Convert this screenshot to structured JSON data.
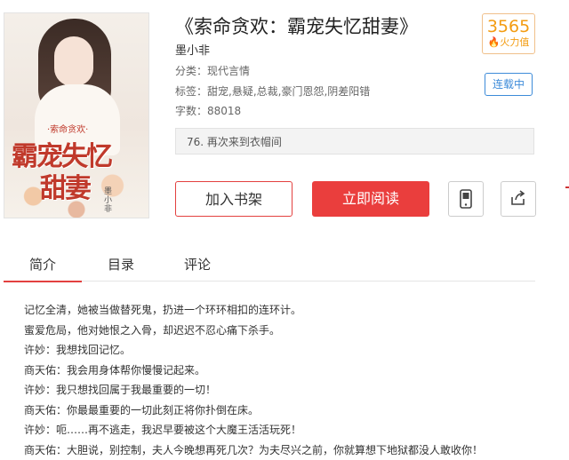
{
  "book": {
    "title": "《索命贪欢：霸宠失忆甜妻》",
    "author": "墨小非",
    "category_label": "分类：",
    "category": "现代言情",
    "tags_label": "标签：",
    "tags": "甜宠,悬疑,总裁,豪门恩怨,阴差阳错",
    "word_count_label": "字数：",
    "word_count": "88018",
    "heat_value": "3565",
    "heat_label": "火力值",
    "status": "连载中",
    "latest_chapter": "76. 再次来到衣帽间"
  },
  "cover": {
    "small_title": "·索命贪欢·",
    "big_title_line1": "霸宠失忆",
    "big_title_line2": "甜妻",
    "author_mark": "墨小非"
  },
  "actions": {
    "add_shelf": "加入书架",
    "read_now": "立即阅读",
    "mobile_icon": "mobile-phone-icon",
    "share_icon": "share-icon"
  },
  "tabs": [
    {
      "label": "简介",
      "active": true
    },
    {
      "label": "目录",
      "active": false
    },
    {
      "label": "评论",
      "active": false
    }
  ],
  "description": [
    "记忆全清，她被当做替死鬼，扔进一个环环相扣的连环计。",
    "蜜爱危局，他对她恨之入骨，却迟迟不忍心痛下杀手。",
    "许妙：我想找回记忆。",
    "商天佑：我会用身体帮你慢慢记起来。",
    "许妙：我只想找回属于我最重要的一切！",
    "商天佑：你最最重要的一切此刻正将你扑倒在床。",
    "许妙：呃……再不逃走，我迟早要被这个大魔王活活玩死！",
    "商天佑：大胆说，别控制，夫人今晚想再死几次？为夫尽兴之前，你就算想下地狱都没人敢收你！"
  ],
  "colors": {
    "accent_red": "#ea3e3d",
    "status_blue": "#3d8bd9",
    "heat_orange": "#f39c12"
  }
}
